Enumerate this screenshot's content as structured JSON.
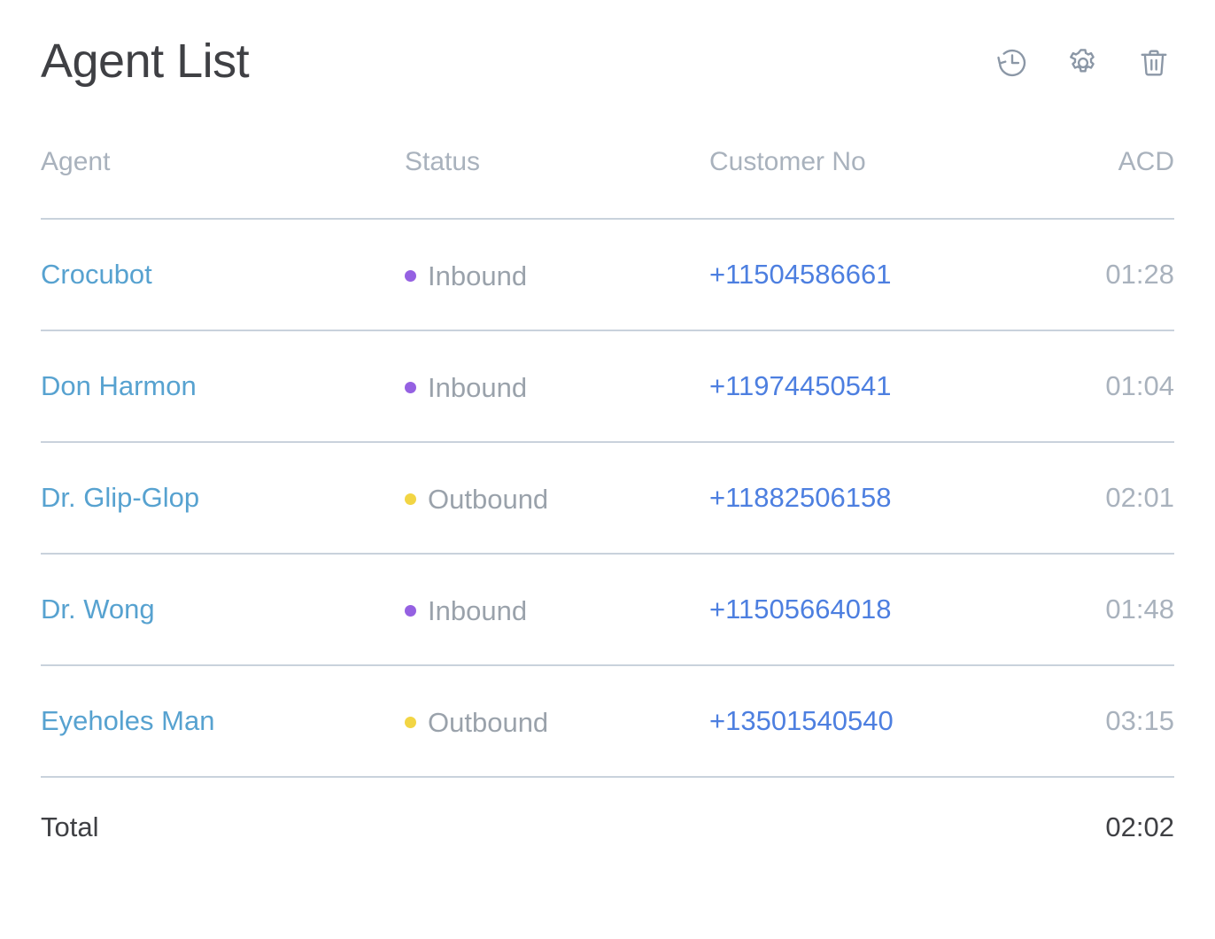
{
  "header": {
    "title": "Agent List",
    "actions": [
      {
        "name": "history-icon",
        "label": "History"
      },
      {
        "name": "gear-icon",
        "label": "Settings"
      },
      {
        "name": "trash-icon",
        "label": "Delete"
      }
    ]
  },
  "table": {
    "columns": [
      {
        "key": "agent",
        "label": "Agent"
      },
      {
        "key": "status",
        "label": "Status"
      },
      {
        "key": "customer",
        "label": "Customer No"
      },
      {
        "key": "acd",
        "label": "ACD"
      }
    ],
    "rows": [
      {
        "agent": "Crocubot",
        "status": "Inbound",
        "status_color": "#9561e2",
        "customer_no": "+11504586661",
        "acd": "01:28"
      },
      {
        "agent": "Don Harmon",
        "status": "Inbound",
        "status_color": "#9561e2",
        "customer_no": "+11974450541",
        "acd": "01:04"
      },
      {
        "agent": "Dr. Glip-Glop",
        "status": "Outbound",
        "status_color": "#f2d544",
        "customer_no": "+11882506158",
        "acd": "02:01"
      },
      {
        "agent": "Dr. Wong",
        "status": "Inbound",
        "status_color": "#9561e2",
        "customer_no": "+11505664018",
        "acd": "01:48"
      },
      {
        "agent": "Eyeholes Man",
        "status": "Outbound",
        "status_color": "#f2d544",
        "customer_no": "+13501540540",
        "acd": "03:15"
      }
    ],
    "footer": {
      "label": "Total",
      "value": "02:02"
    }
  },
  "colors": {
    "title": "#3f4044",
    "header_text": "#a9b2bd",
    "agent_link": "#57a2d0",
    "phone_link": "#4d7fe0",
    "status_text": "#9aa2ab",
    "acd_text": "#a9b2bd",
    "divider": "#c9d2dc",
    "icon": "#8b97a6",
    "background": "#ffffff",
    "inbound_dot": "#9561e2",
    "outbound_dot": "#f2d544"
  }
}
